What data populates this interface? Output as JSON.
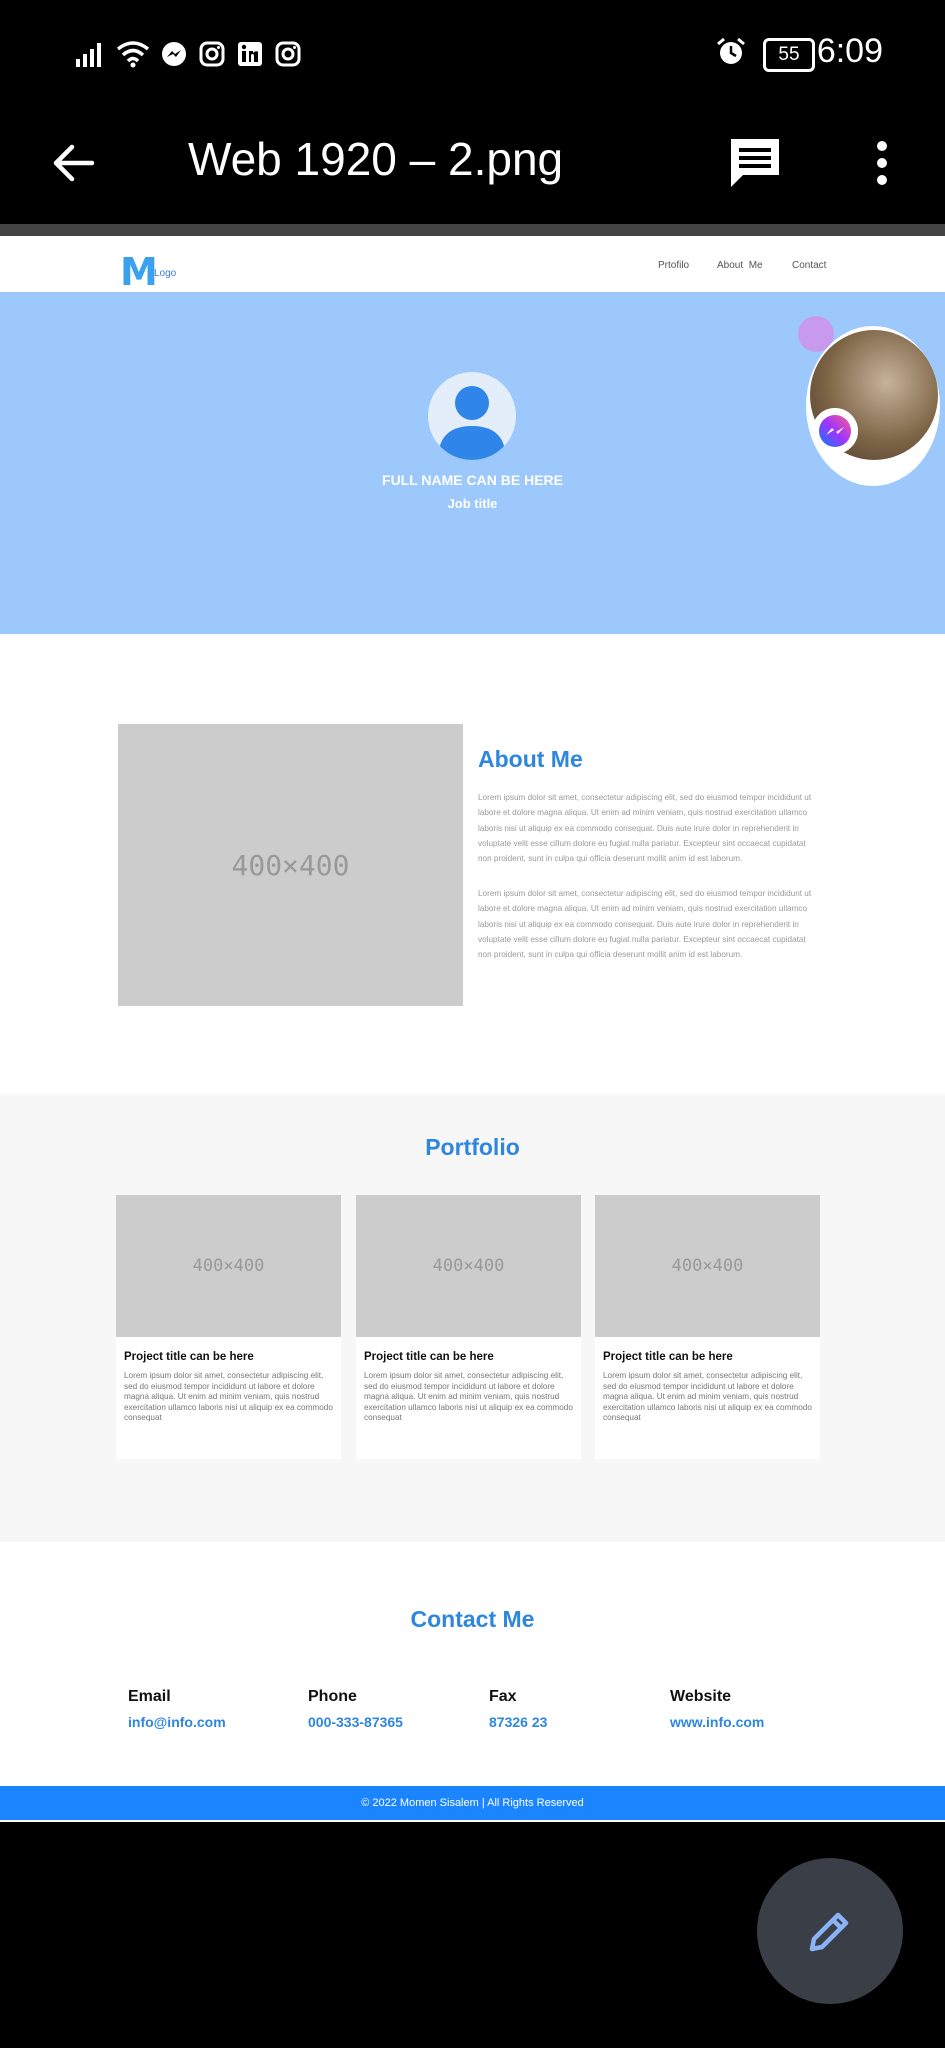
{
  "status_bar": {
    "battery": "55",
    "time": "6:09"
  },
  "app_bar": {
    "title": "Web 1920 – 2.png"
  },
  "site": {
    "logo_letter": "M",
    "logo_text": "Logo",
    "nav": [
      "Prtofilo",
      "About  Me",
      "Contact"
    ],
    "hero": {
      "name": "FULL NAME CAN BE HERE",
      "job": "Job title"
    },
    "about": {
      "image_label": "400×400",
      "title": "About Me",
      "paragraphs": [
        "Lorem ipsum dolor sit amet, consectetur adipiscing elit, sed do eiusmod tempor incididunt ut labore et dolore magna aliqua. Ut enim ad minim veniam, quis nostrud exercitation ullamco laboris nisi ut aliquip ex ea commodo consequat. Duis aute irure dolor in reprehenderit in voluptate velit esse cillum dolore eu fugiat nulla pariatur. Excepteur sint occaecat cupidatat non proident, sunt in culpa qui officia deserunt mollit anim id est laborum.",
        "Lorem ipsum dolor sit amet, consectetur adipiscing elit, sed do eiusmod tempor incididunt ut labore et dolore magna aliqua. Ut enim ad minim veniam, quis nostrud exercitation ullamco laboris nisi ut aliquip ex ea commodo consequat. Duis aute irure dolor in reprehenderit in voluptate velit esse cillum dolore eu fugiat nulla pariatur. Excepteur sint occaecat cupidatat non proident, sunt in culpa qui officia deserunt mollit anim id est laborum."
      ]
    },
    "portfolio": {
      "title": "Portfolio",
      "cards": [
        {
          "image_label": "400×400",
          "title": "Project title can be here",
          "text": "Lorem ipsum dolor sit amet, consectetur adipiscing elit, sed do eiusmod tempor incididunt ut labore et dolore magna aliqua. Ut enim ad minim veniam, quis nostrud exercitation ullamco laboris nisi ut aliquip ex ea commodo consequat"
        },
        {
          "image_label": "400×400",
          "title": "Project title can be here",
          "text": "Lorem ipsum dolor sit amet, consectetur adipiscing elit, sed do eiusmod tempor incididunt ut labore et dolore magna aliqua. Ut enim ad minim veniam, quis nostrud exercitation ullamco laboris nisi ut aliquip ex ea commodo consequat"
        },
        {
          "image_label": "400×400",
          "title": "Project title can be here",
          "text": "Lorem ipsum dolor sit amet, consectetur adipiscing elit, sed do eiusmod tempor incididunt ut labore et dolore magna aliqua. Ut enim ad minim veniam, quis nostrud exercitation ullamco laboris nisi ut aliquip ex ea commodo consequat"
        }
      ]
    },
    "contact": {
      "title": "Contact Me",
      "items": [
        {
          "label": "Email",
          "value": "info@info.com"
        },
        {
          "label": "Phone",
          "value": "000-333-87365"
        },
        {
          "label": "Fax",
          "value": "87326 23"
        },
        {
          "label": "Website",
          "value": "www.info.com"
        }
      ]
    },
    "footer": "© 2022 Momen Sisalem | All Rights Reserved"
  },
  "colors": {
    "accent": "#2e86de",
    "hero_bg": "#9cc8fb",
    "footer_bg": "#1a85ff"
  }
}
